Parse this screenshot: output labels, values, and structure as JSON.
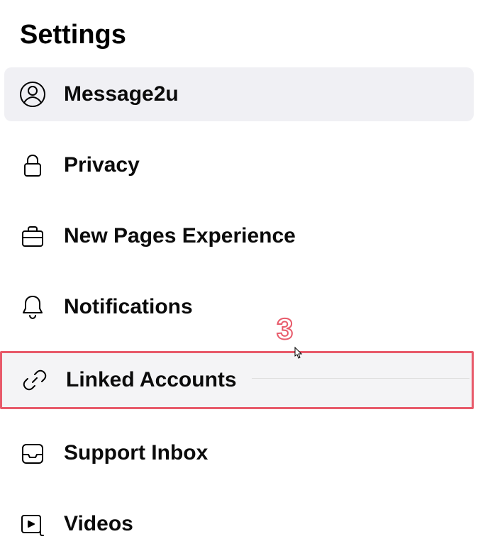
{
  "title": "Settings",
  "menu": {
    "items": [
      {
        "label": "Message2u",
        "icon": "person-icon",
        "selected": true
      },
      {
        "label": "Privacy",
        "icon": "lock-icon"
      },
      {
        "label": "New Pages Experience",
        "icon": "briefcase-icon"
      },
      {
        "label": "Notifications",
        "icon": "bell-icon"
      },
      {
        "label": "Linked Accounts",
        "icon": "link-icon",
        "highlighted": true,
        "hover": true
      },
      {
        "label": "Support Inbox",
        "icon": "inbox-icon"
      },
      {
        "label": "Videos",
        "icon": "video-icon"
      }
    ]
  },
  "annotation": {
    "step": "3"
  }
}
